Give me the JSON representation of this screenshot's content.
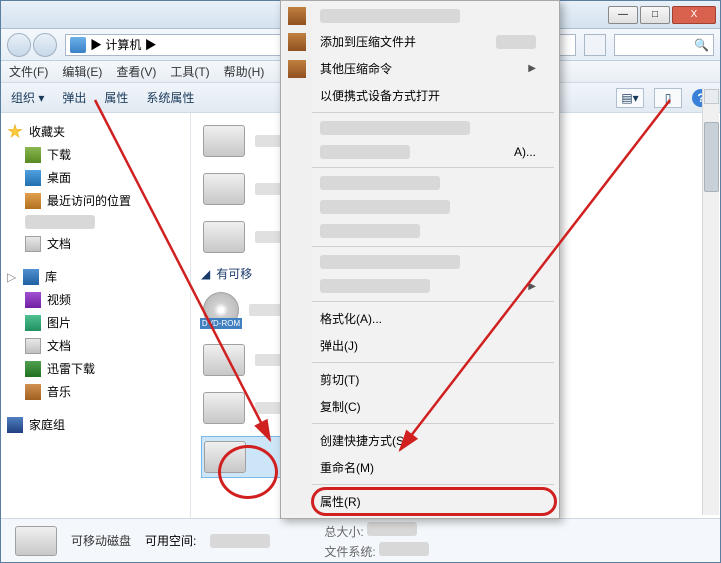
{
  "titlebar": {
    "min": "—",
    "max": "□",
    "close": "X"
  },
  "nav": {
    "address": "▶ 计算机 ▶"
  },
  "menu": {
    "file": "文件(F)",
    "edit": "编辑(E)",
    "view": "查看(V)",
    "tools": "工具(T)",
    "help": "帮助(H)"
  },
  "toolbar": {
    "organize": "组织 ▾",
    "eject": "弹出",
    "props": "属性",
    "sysprops": "系统属性"
  },
  "sidebar": {
    "fav": {
      "label": "收藏夹",
      "items": [
        {
          "icon": "ico-dl",
          "label": "下载"
        },
        {
          "icon": "ico-desktop",
          "label": "桌面"
        },
        {
          "icon": "ico-recent",
          "label": "最近访问的位置"
        },
        {
          "icon": "ico-doc",
          "label": "文档"
        }
      ]
    },
    "lib": {
      "label": "库",
      "items": [
        {
          "icon": "ico-vid",
          "label": "视频"
        },
        {
          "icon": "ico-pic",
          "label": "图片"
        },
        {
          "icon": "ico-doc",
          "label": "文档"
        },
        {
          "icon": "ico-xl",
          "label": "迅雷下载"
        },
        {
          "icon": "ico-music",
          "label": "音乐"
        }
      ]
    },
    "home": {
      "label": "家庭组"
    }
  },
  "content": {
    "removable_header": "有可移"
  },
  "status": {
    "type": "可移动磁盘",
    "free": "可用空间:",
    "total_label": "总大小:",
    "fs_label": "文件系统:"
  },
  "ctx": {
    "addcompress": "添加到压缩文件并",
    "othercompress": "其他压缩命令",
    "portable": "以便携式设备方式打开",
    "a_suffix": "A)...",
    "format": "格式化(A)...",
    "eject": "弹出(J)",
    "cut": "剪切(T)",
    "copy": "复制(C)",
    "shortcut": "创建快捷方式(S)",
    "rename": "重命名(M)",
    "props": "属性(R)"
  }
}
